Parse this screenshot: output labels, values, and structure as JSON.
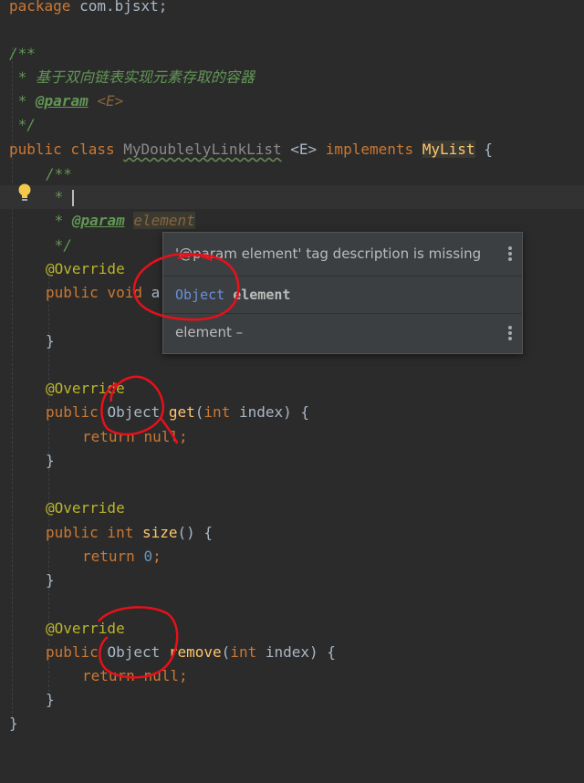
{
  "code": {
    "l1_kw": "package",
    "l1_rest": " com.bjsxt;",
    "l2_open": "/**",
    "l3": " * 基于双向链表实现元素存取的容器",
    "l4_star": " * ",
    "l4_tag": "@param",
    "l4_sp": " ",
    "l4_type": "<E>",
    "l5": " */",
    "l6_kw": "public class ",
    "l6_name": "MyDoublelyLinkList",
    "l6_type": " <E> ",
    "l6_impl": "implements ",
    "l6_iface": "MyList",
    "l6_brace": " {",
    "l7": "/**",
    "l8_star": " * ",
    "l9_star": " * ",
    "l9_tag": "@param",
    "l9_sp": " ",
    "l9_name": "element",
    "l10": " */",
    "override": "@Override",
    "add_kw": "public void ",
    "add_name": "a",
    "close_brace": "}",
    "get_kw": "public ",
    "get_type": "Object ",
    "get_name": "get",
    "get_params_open": "(",
    "get_params_kw": "int",
    "get_params_rest": " index) {",
    "return_kw": "return ",
    "null_val": "null",
    "semicolon": ";",
    "size_kw": "public int ",
    "size_name": "size",
    "size_rest": "() {",
    "zero_val": "0",
    "remove_kw": "public ",
    "remove_type": "Object ",
    "remove_name": "remove",
    "remove_params_open": "(",
    "remove_params_kw": "int",
    "remove_params_rest": " index) {",
    "final_brace": "}"
  },
  "popup": {
    "warning": "'@param element' tag description is missing",
    "param_type": "Object",
    "param_name": "element",
    "param_desc": "element –"
  },
  "icons": {
    "gutter": "lightbulb-icon",
    "menu": "more-vertical-icon"
  },
  "colors": {
    "background": "#2b2b2b",
    "keyword": "#cc7832",
    "comment": "#629755",
    "annotation": "#bbb529",
    "function": "#ffc66d",
    "number": "#6897bb",
    "marker": "#e8101a"
  }
}
